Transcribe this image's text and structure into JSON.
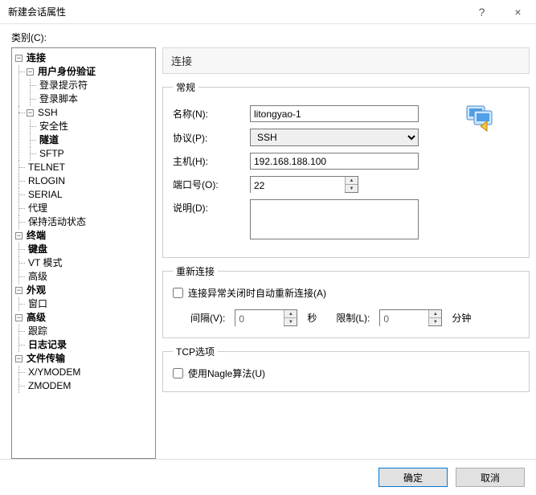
{
  "titlebar": {
    "title": "新建会话属性",
    "help": "?",
    "close": "×"
  },
  "category_label": "类别(C):",
  "tree": {
    "connection": "连接",
    "userauth": "用户身份验证",
    "loginprompt": "登录提示符",
    "loginscript": "登录脚本",
    "ssh": "SSH",
    "security": "安全性",
    "tunnel": "隧道",
    "sftp": "SFTP",
    "telnet": "TELNET",
    "rlogin": "RLOGIN",
    "serial": "SERIAL",
    "proxy": "代理",
    "keepalive": "保持活动状态",
    "terminal": "终端",
    "keyboard": "键盘",
    "vtmode": "VT 模式",
    "advanced": "高级",
    "appearance": "外观",
    "window": "窗口",
    "advanced2": "高级",
    "trace": "跟踪",
    "logging": "日志记录",
    "filetransfer": "文件传输",
    "xymodem": "X/YMODEM",
    "zmodem": "ZMODEM"
  },
  "header": {
    "connection": "连接"
  },
  "general": {
    "legend": "常规",
    "name_label": "名称(N):",
    "name_value": "litongyao-1",
    "proto_label": "协议(P):",
    "proto_value": "SSH",
    "host_label": "主机(H):",
    "host_value": "192.168.188.100",
    "port_label": "端口号(O):",
    "port_value": "22",
    "desc_label": "说明(D):",
    "desc_value": ""
  },
  "reconnect": {
    "legend": "重新连接",
    "auto_label": "连接异常关闭时自动重新连接(A)",
    "interval_label": "间隔(V):",
    "interval_value": "0",
    "sec": "秒",
    "limit_label": "限制(L):",
    "limit_value": "0",
    "min": "分钟"
  },
  "tcp": {
    "legend": "TCP选项",
    "nagle_label": "使用Nagle算法(U)"
  },
  "footer": {
    "ok": "确定",
    "cancel": "取消"
  }
}
